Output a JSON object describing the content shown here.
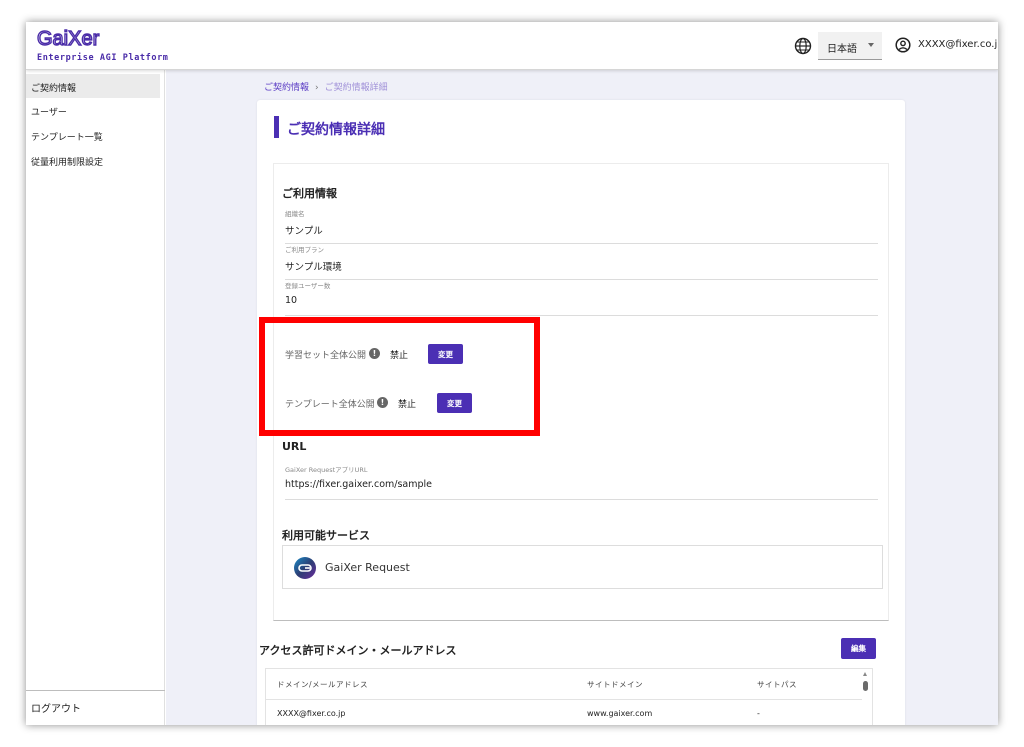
{
  "header": {
    "logo_text": "GaiXer",
    "logo_subtitle": "Enterprise AGI Platform",
    "language": "日本語",
    "user_email": "XXXX@fixer.co.jp",
    "icons": [
      "globe-icon",
      "account-circle-icon",
      "chevron-down-icon"
    ]
  },
  "sidebar": {
    "items": [
      {
        "label": "ご契約情報",
        "active": true
      },
      {
        "label": "ユーザー",
        "active": false
      },
      {
        "label": "テンプレート一覧",
        "active": false
      },
      {
        "label": "従量利用制限設定",
        "active": false
      }
    ],
    "logout_label": "ログアウト"
  },
  "breadcrumb": {
    "parent": "ご契約情報",
    "separator": "›",
    "current": "ご契約情報詳細"
  },
  "page": {
    "title": "ご契約情報詳細"
  },
  "usage_info": {
    "section_title": "ご利用情報",
    "fields": [
      {
        "label": "組織名",
        "value": "サンプル"
      },
      {
        "label": "ご利用プラン",
        "value": "サンプル環境"
      },
      {
        "label": "登録ユーザー数",
        "value": "10"
      }
    ]
  },
  "public_settings": {
    "learning_set": {
      "label": "学習セット全体公開",
      "status": "禁止",
      "button_label": "変更"
    },
    "template": {
      "label": "テンプレート全体公開",
      "status": "禁止",
      "button_label": "変更"
    }
  },
  "url": {
    "section_title": "URL",
    "field_label": "GaiXer RequestアプリURL",
    "value": "https://fixer.gaixer.com/sample"
  },
  "services": {
    "section_title": "利用可能サービス",
    "items": [
      {
        "name": "GaiXer Request"
      }
    ]
  },
  "access_domains": {
    "section_title": "アクセス許可ドメイン・メールアドレス",
    "edit_label": "編集",
    "columns": [
      "ドメイン/メールアドレス",
      "サイトドメイン",
      "サイトパス"
    ],
    "rows": [
      {
        "domain": "XXXX@fixer.co.jp",
        "site_domain": "www.gaixer.com",
        "site_path": "-"
      }
    ]
  },
  "colors": {
    "accent": "#4b2fb4",
    "highlight": "#ff0000",
    "main_background": "#eff0f8"
  }
}
